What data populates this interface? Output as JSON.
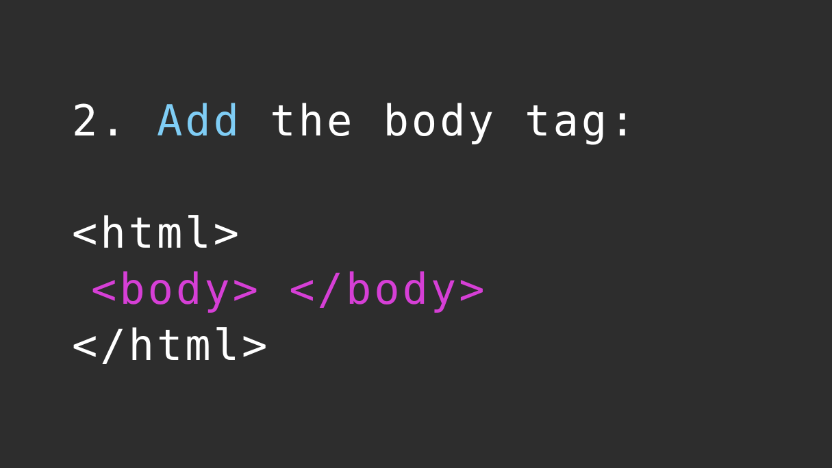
{
  "heading": {
    "number": "2.",
    "verb": "Add",
    "rest": "the body tag:"
  },
  "code": {
    "open_html": "<html>",
    "open_body": "<body>",
    "close_body": "</body>",
    "close_html": "</html>"
  },
  "colors": {
    "background": "#2d2d2d",
    "text": "#ffffff",
    "accent": "#7fcdf5",
    "tag": "#d63fd6"
  }
}
